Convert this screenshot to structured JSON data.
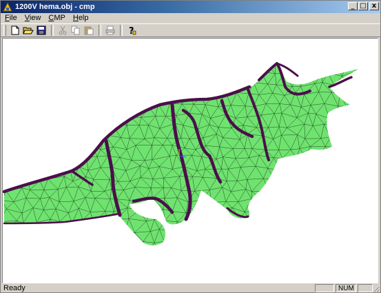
{
  "window": {
    "title": "1200V  hema.obj - cmp",
    "minimize": "_",
    "maximize": "□",
    "close": "x"
  },
  "menu": {
    "file": {
      "accel": "F",
      "rest": "ile"
    },
    "view": {
      "accel": "V",
      "rest": "iew"
    },
    "cmp": {
      "accel": "C",
      "rest": "MP"
    },
    "help": {
      "accel": "H",
      "rest": "elp"
    }
  },
  "toolbar": {
    "icons": [
      "new-icon",
      "open-icon",
      "save-icon",
      "cut-icon",
      "copy-icon",
      "paste-icon",
      "print-icon",
      "about-icon"
    ]
  },
  "viewport": {
    "model": "triceratops mesh",
    "colors": {
      "background": "#ffffff",
      "mesh_fill": "#6fe26f",
      "mesh_lines": "#1a3a1a",
      "seams": "#4b0f4b"
    }
  },
  "status": {
    "text": "Ready",
    "num": "NUM"
  }
}
